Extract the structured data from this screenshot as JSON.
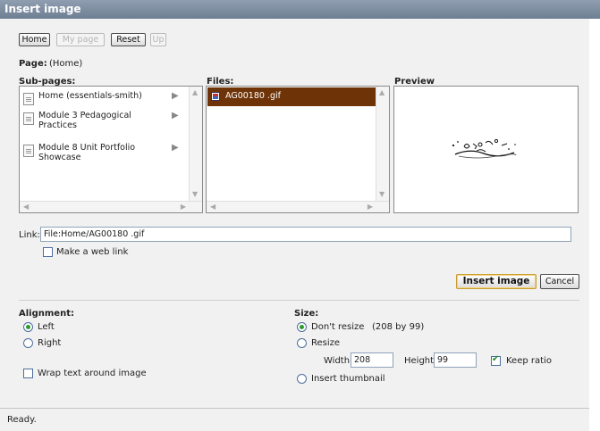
{
  "window": {
    "title": "Insert image"
  },
  "nav": {
    "home": "Home",
    "mypage": "My page",
    "reset": "Reset",
    "up": "Up"
  },
  "page": {
    "label": "Page:",
    "value": "(Home)"
  },
  "subpages": {
    "header": "Sub-pages:",
    "items": [
      {
        "label": "Home (essentials-smith)"
      },
      {
        "label": "Module 3 Pedagogical Practices"
      },
      {
        "label": "Module 8 Unit Portfolio Showcase"
      }
    ]
  },
  "files": {
    "header": "Files:",
    "items": [
      {
        "label": "AG00180 .gif"
      }
    ]
  },
  "preview": {
    "header": "Preview"
  },
  "link": {
    "label": "Link:",
    "value": "File:Home/AG00180 .gif",
    "web_link": "Make a web link"
  },
  "actions": {
    "insert": "Insert image",
    "cancel": "Cancel"
  },
  "alignment": {
    "label": "Alignment:",
    "left": "Left",
    "right": "Right",
    "selected": "Left",
    "wrap": "Wrap text around image"
  },
  "size": {
    "label": "Size:",
    "dont_resize": "Don't resize",
    "dims": "(208 by 99)",
    "resize": "Resize",
    "width_label": "Width:",
    "width": "208",
    "height_label": "Height:",
    "height": "99",
    "keep_ratio": "Keep ratio",
    "keep_ratio_checked": true,
    "thumbnail": "Insert thumbnail",
    "selected": "Don't resize"
  },
  "status": {
    "text": "Ready."
  },
  "colors": {
    "selection": "#6e3408",
    "titlebar": "#7d8da0",
    "radio": "#2d9a2d"
  }
}
